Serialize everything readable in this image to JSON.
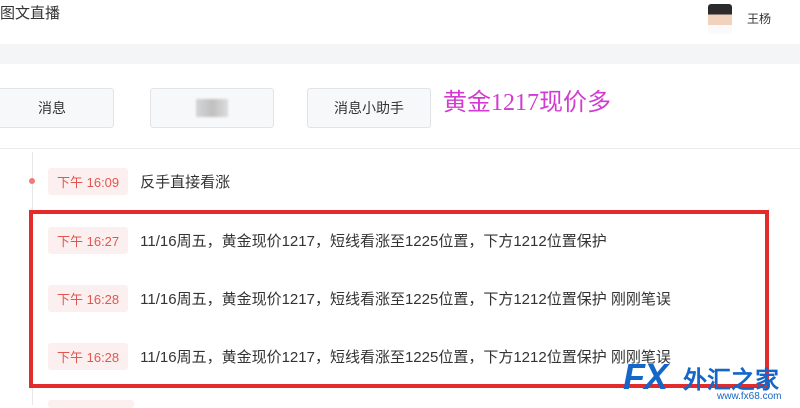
{
  "header": {
    "title": "图文直播",
    "user_name": "王杨"
  },
  "toolbar": {
    "buttons": [
      {
        "label": "消息"
      },
      {
        "label": ""
      },
      {
        "label": "消息小助手"
      }
    ]
  },
  "annotation": {
    "text": "黄金1217现价多",
    "color": "#d13bd1"
  },
  "feed": {
    "items": [
      {
        "time": "下午 16:09",
        "text": "反手直接看涨"
      },
      {
        "time": "下午 16:27",
        "text": "11/16周五，黄金现价1217，短线看涨至1225位置，下方1212位置保护"
      },
      {
        "time": "下午 16:28",
        "text": "11/16周五，黄金现价1217，短线看涨至1225位置，下方1212位置保护 刚刚笔误"
      },
      {
        "time": "下午 16:28",
        "text": "11/16周五，黄金现价1217，短线看涨至1225位置，下方1212位置保护 刚刚笔误"
      }
    ]
  },
  "watermark": {
    "logo": "FX",
    "name": "外汇之家",
    "url": "www.fx68.com"
  },
  "colors": {
    "highlight_box": "#e32b2b",
    "time_tag_text": "#e3564f",
    "time_tag_bg": "#fcefef",
    "watermark": "#1466c9"
  }
}
